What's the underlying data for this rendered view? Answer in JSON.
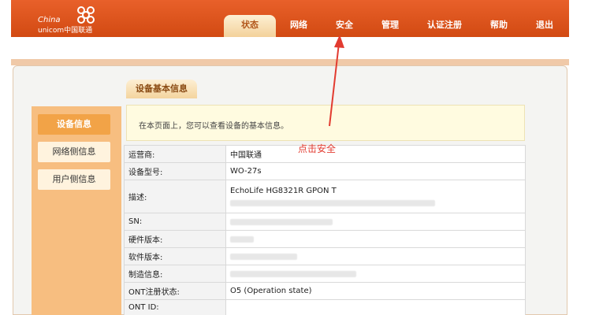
{
  "brand": {
    "name_en_line1": "China",
    "name_en_line2": "unicom中国联通"
  },
  "nav": {
    "items": [
      {
        "label": "状态",
        "active": true
      },
      {
        "label": "网络",
        "active": false
      },
      {
        "label": "安全",
        "active": false
      },
      {
        "label": "管理",
        "active": false
      },
      {
        "label": "认证注册",
        "active": false
      },
      {
        "label": "帮助",
        "active": false
      },
      {
        "label": "退出",
        "active": false
      }
    ]
  },
  "sidebar": {
    "items": [
      {
        "label": "设备信息",
        "active": true
      },
      {
        "label": "网络侧信息",
        "active": false
      },
      {
        "label": "用户侧信息",
        "active": false
      }
    ]
  },
  "section": {
    "tab_label": "设备基本信息",
    "description": "在本页面上，您可以查看设备的基本信息。"
  },
  "device_table": {
    "rows": [
      {
        "label": "运营商:",
        "value": "中国联通"
      },
      {
        "label": "设备型号:",
        "value": "WO-27s"
      },
      {
        "label": "描述:",
        "value": "EchoLife HG8321R GPON T"
      },
      {
        "label": "SN:",
        "value": ""
      },
      {
        "label": "硬件版本:",
        "value": ""
      },
      {
        "label": "软件版本:",
        "value": ""
      },
      {
        "label": "制造信息:",
        "value": ""
      },
      {
        "label": "ONT注册状态:",
        "value": "O5 (Operation state)"
      },
      {
        "label": "ONT ID:",
        "value": ""
      }
    ]
  },
  "annotation": {
    "text": "点击安全",
    "color": "#e23b30"
  },
  "colors": {
    "header": "#d24a12",
    "sidebar": "#f7be80",
    "sidebar_active": "#f2a347"
  }
}
